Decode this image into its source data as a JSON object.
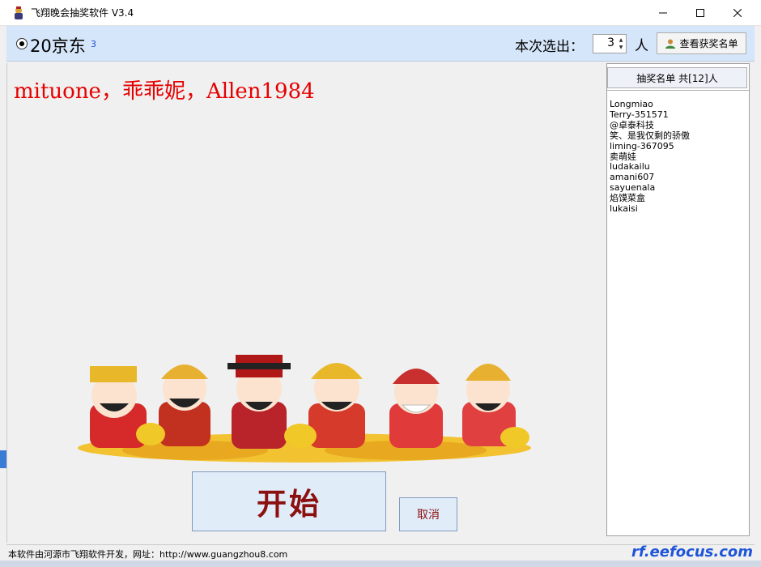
{
  "window": {
    "title": "飞翔晚会抽奖软件 V3.4"
  },
  "topbar": {
    "prize_name": "20京东",
    "prize_count": "3",
    "draw_label": "本次选出：",
    "draw_count": "3",
    "unit_label": "人",
    "view_winners_label": "查看获奖名单"
  },
  "main": {
    "current_winners": "mituone，乖乖妮，Allen1984",
    "start_label": "开始",
    "cancel_label": "取消"
  },
  "winner_list": {
    "header": "抽奖名单 共[12]人",
    "names": [
      "Longmiao",
      "Terry-351571",
      "@卓泰科技",
      "笑、是我仅剩的骄傲",
      "liming-367095",
      "卖萌娃",
      "ludakailu",
      "amani607",
      "sayuenala",
      "焰馍菜盒",
      "lukaisi"
    ]
  },
  "statusbar": {
    "text": "本软件由河源市飞翔软件开发，网址：http://www.guangzhou8.com",
    "watermark": "rf.eefocus.com"
  },
  "colors": {
    "winner_text": "#e60000",
    "start_text": "#8b1010",
    "topbar_bg": "#d6e6fa",
    "watermark": "#1e55d8"
  },
  "icons": [
    "app-icon",
    "minimize-icon",
    "maximize-icon",
    "close-icon",
    "user-icon",
    "radio-selected-icon"
  ]
}
